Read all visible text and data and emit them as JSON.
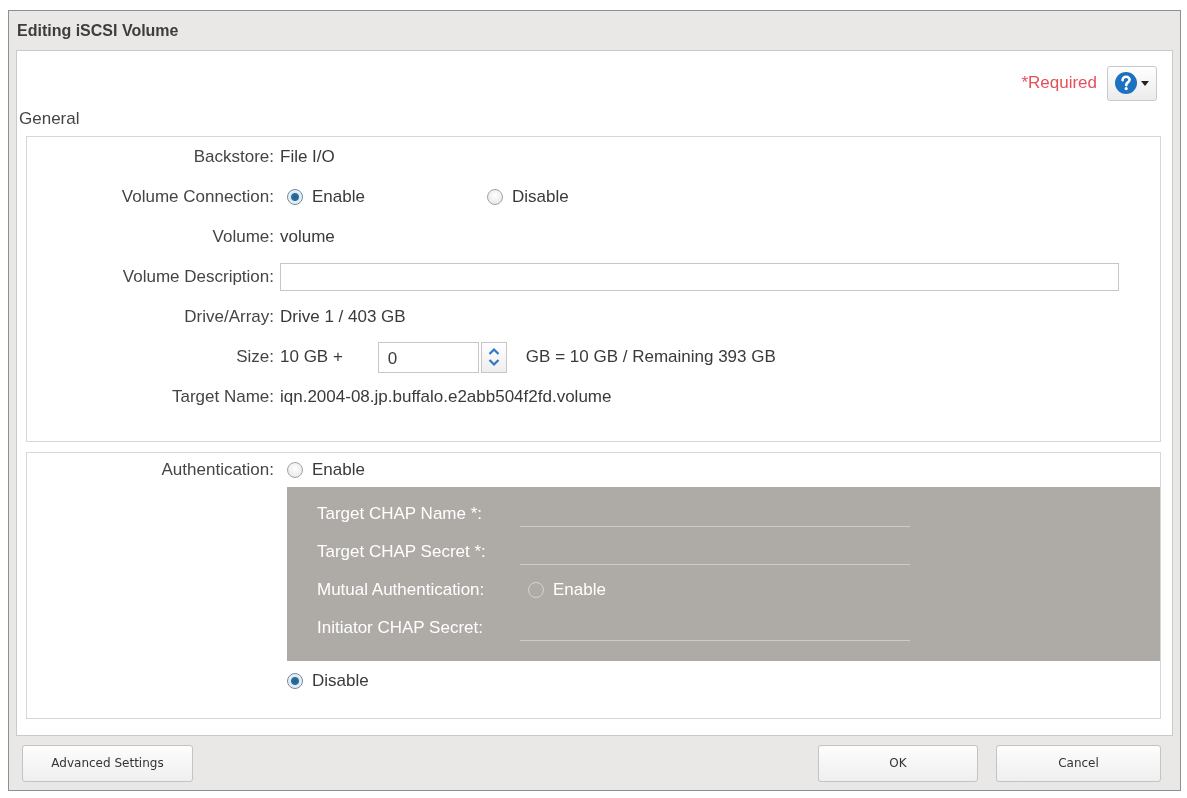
{
  "window": {
    "title": "Editing iSCSI Volume"
  },
  "toolbar": {
    "required_note": "*Required"
  },
  "general": {
    "heading": "General",
    "rows": [
      {
        "kind": "text",
        "label": "Backstore:",
        "value": "File I/O"
      },
      {
        "kind": "radio",
        "label": "Volume Connection:",
        "options": [
          {
            "label": "Enable",
            "selected": true
          },
          {
            "label": "Disable",
            "selected": false
          }
        ]
      },
      {
        "kind": "text",
        "label": "Volume:",
        "value": "volume"
      },
      {
        "kind": "input",
        "label": "Volume Description:"
      },
      {
        "kind": "text",
        "label": "Drive/Array:",
        "value": "Drive 1 / 403 GB"
      },
      {
        "kind": "size",
        "label": "Size:",
        "prefix": "10 GB +",
        "value": "0",
        "suffix": "GB = 10 GB / Remaining 393 GB"
      },
      {
        "kind": "text",
        "label": "Target Name:",
        "value": "iqn.2004-08.jp.buffalo.e2abb504f2fd.volume"
      }
    ]
  },
  "authentication": {
    "label": "Authentication:",
    "options": [
      {
        "label": "Enable",
        "selected": false
      },
      {
        "label": "Disable",
        "selected": true
      }
    ],
    "chap_panel": {
      "disabled": true,
      "rows": [
        {
          "kind": "input",
          "label": "Target CHAP Name *:"
        },
        {
          "kind": "input",
          "label": "Target CHAP Secret *:"
        },
        {
          "kind": "radio",
          "label": "Mutual Authentication:",
          "options": [
            {
              "label": "Enable",
              "selected": false
            }
          ]
        },
        {
          "kind": "input",
          "label": "Initiator CHAP Secret:"
        }
      ]
    }
  },
  "footer": {
    "buttons": [
      "Advanced Settings",
      "OK",
      "Cancel"
    ]
  }
}
